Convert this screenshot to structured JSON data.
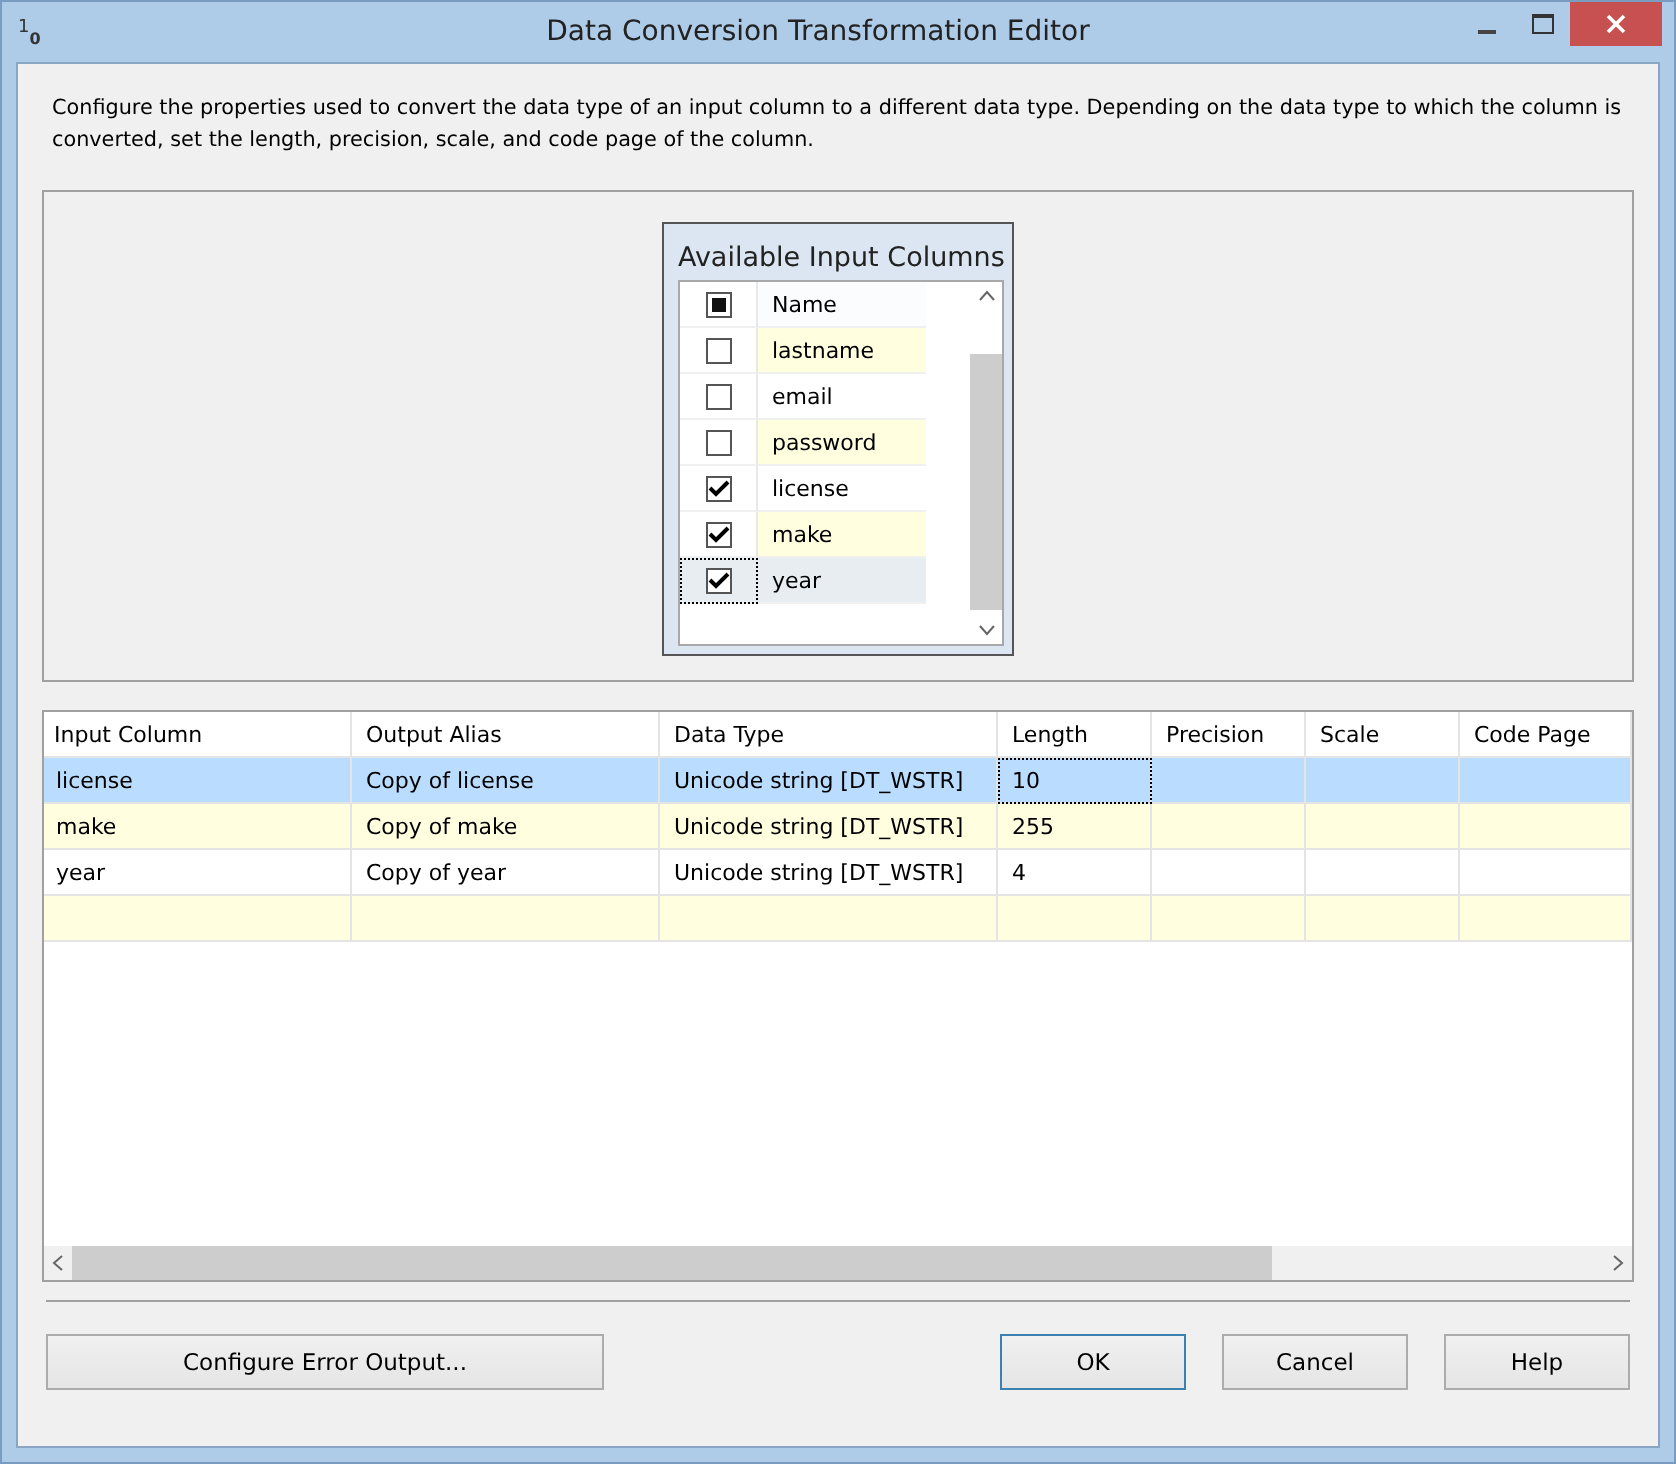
{
  "window": {
    "title": "Data Conversion Transformation Editor",
    "icon_text": "1",
    "icon_sub": "0"
  },
  "description": "Configure the properties used to convert the data type of an input column to a different data type. Depending on the data type to which the column is converted, set the length, precision, scale, and code page of the column.",
  "available_columns": {
    "title": "Available Input Columns",
    "header": "Name",
    "select_all_partial": true,
    "items": [
      {
        "name": "lastname",
        "checked": false,
        "selected": false
      },
      {
        "name": "email",
        "checked": false,
        "selected": false
      },
      {
        "name": "password",
        "checked": false,
        "selected": false
      },
      {
        "name": "license",
        "checked": true,
        "selected": false
      },
      {
        "name": "make",
        "checked": true,
        "selected": false
      },
      {
        "name": "year",
        "checked": true,
        "selected": true
      }
    ]
  },
  "grid": {
    "columns": [
      "Input Column",
      "Output Alias",
      "Data Type",
      "Length",
      "Precision",
      "Scale",
      "Code Page"
    ],
    "rows": [
      {
        "cells": [
          "license",
          "Copy of license",
          "Unicode string [DT_WSTR]",
          "10",
          "",
          "",
          ""
        ],
        "selected": true
      },
      {
        "cells": [
          "make",
          "Copy of make",
          "Unicode string [DT_WSTR]",
          "255",
          "",
          "",
          ""
        ],
        "selected": false
      },
      {
        "cells": [
          "year",
          "Copy of year",
          "Unicode string [DT_WSTR]",
          "4",
          "",
          "",
          ""
        ],
        "selected": false
      }
    ]
  },
  "buttons": {
    "left": "Configure Error Output...",
    "right": [
      {
        "label": "OK",
        "default": true
      },
      {
        "label": "Cancel",
        "default": false
      },
      {
        "label": "Help",
        "default": false
      }
    ]
  }
}
